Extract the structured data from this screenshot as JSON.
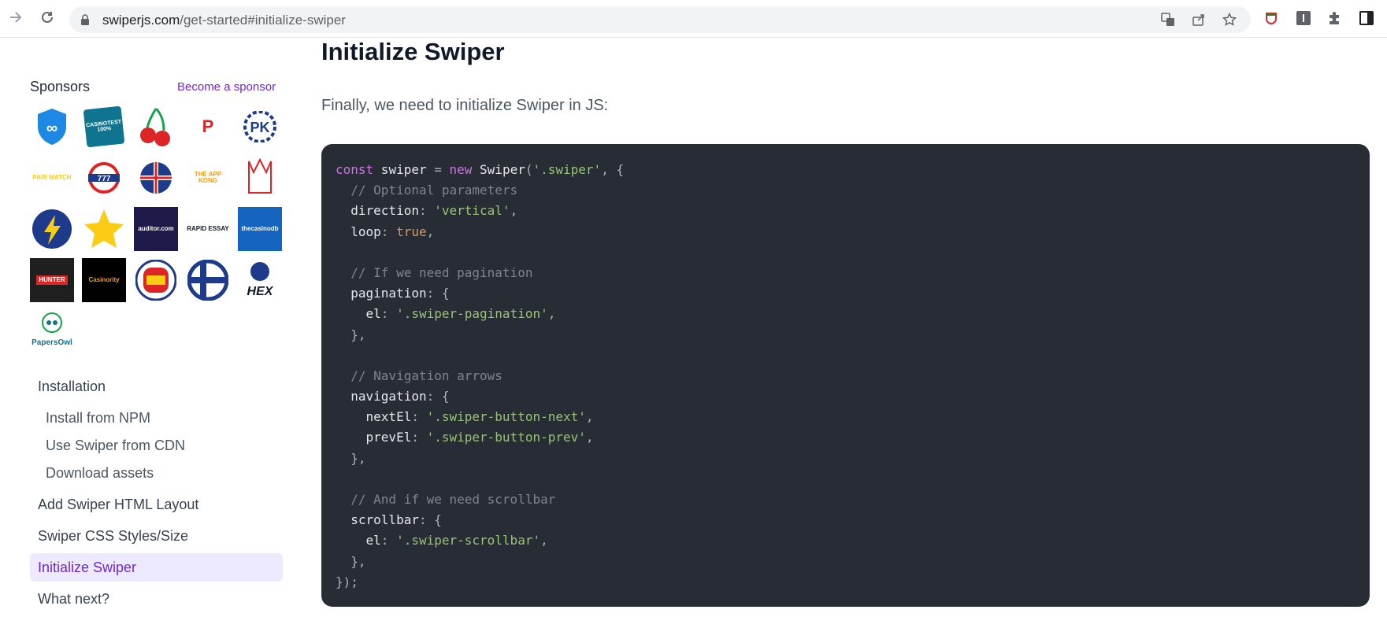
{
  "browser": {
    "url_host": "swiperjs.com",
    "url_path": "/get-started#initialize-swiper"
  },
  "sidebar": {
    "sponsors_title": "Sponsors",
    "become_sponsor": "Become a sponsor",
    "sponsors": [
      {
        "name": "shield-logo",
        "label": "",
        "color": "#1e88e5"
      },
      {
        "name": "casinotest-logo",
        "label": "CASINOTEST",
        "color": "#0e7490"
      },
      {
        "name": "cherry-logo",
        "label": "",
        "color": "#dc2626"
      },
      {
        "name": "p-logo",
        "label": "P",
        "color": "#dc2626"
      },
      {
        "name": "pk-logo",
        "label": "PK",
        "color": "#1e3a8a"
      },
      {
        "name": "parimatch-logo",
        "label": "PARI MATCH",
        "color": "#facc15"
      },
      {
        "name": "777-logo",
        "label": "777",
        "color": "#dc2626"
      },
      {
        "name": "uk-logo",
        "label": "",
        "color": "#1e3a8a"
      },
      {
        "name": "theappkong-logo",
        "label": "THE APP KONG",
        "color": "#f59e0b"
      },
      {
        "name": "crown-logo",
        "label": "",
        "color": "#dc2626"
      },
      {
        "name": "lightning-logo",
        "label": "",
        "color": "#1e3a8a"
      },
      {
        "name": "star-logo",
        "label": "",
        "color": "#facc15"
      },
      {
        "name": "auditor-logo",
        "label": "auditor.com",
        "color": "#1e1b4b"
      },
      {
        "name": "rapidessay-logo",
        "label": "RAPID ESSAY",
        "color": "#111827"
      },
      {
        "name": "thecasinodb-logo",
        "label": "thecasinodb",
        "color": "#1565c0"
      },
      {
        "name": "casinohunter-logo",
        "label": "HUNTER",
        "color": "#dc2626"
      },
      {
        "name": "casinority-logo",
        "label": "Casinority",
        "color": "#f59e0b"
      },
      {
        "name": "dutch-logo",
        "label": "",
        "color": "#dc2626"
      },
      {
        "name": "finland-logo",
        "label": "",
        "color": "#1e3a8a"
      },
      {
        "name": "hex-logo",
        "label": "HEX",
        "color": "#111827"
      },
      {
        "name": "papersowl-logo",
        "label": "PapersOwl",
        "color": "#0e7490"
      }
    ],
    "nav": {
      "installation": "Installation",
      "install_npm": "Install from NPM",
      "use_cdn": "Use Swiper from CDN",
      "download_assets": "Download assets",
      "add_layout": "Add Swiper HTML Layout",
      "css_styles": "Swiper CSS Styles/Size",
      "initialize": "Initialize Swiper",
      "what_next": "What next?"
    }
  },
  "main": {
    "title": "Initialize Swiper",
    "intro": "Finally, we need to initialize Swiper in JS:",
    "code_lines": [
      [
        {
          "t": "kw",
          "v": "const"
        },
        {
          "t": "prop",
          "v": " swiper "
        },
        {
          "t": "punc",
          "v": "= "
        },
        {
          "t": "kw",
          "v": "new"
        },
        {
          "t": "fn",
          "v": " Swiper"
        },
        {
          "t": "punc",
          "v": "("
        },
        {
          "t": "str",
          "v": "'.swiper'"
        },
        {
          "t": "punc",
          "v": ", {"
        }
      ],
      [
        {
          "t": "cmt",
          "v": "  // Optional parameters"
        }
      ],
      [
        {
          "t": "prop",
          "v": "  direction"
        },
        {
          "t": "punc",
          "v": ": "
        },
        {
          "t": "str",
          "v": "'vertical'"
        },
        {
          "t": "punc",
          "v": ","
        }
      ],
      [
        {
          "t": "prop",
          "v": "  loop"
        },
        {
          "t": "punc",
          "v": ": "
        },
        {
          "t": "bool",
          "v": "true"
        },
        {
          "t": "punc",
          "v": ","
        }
      ],
      [],
      [
        {
          "t": "cmt",
          "v": "  // If we need pagination"
        }
      ],
      [
        {
          "t": "prop",
          "v": "  pagination"
        },
        {
          "t": "punc",
          "v": ": {"
        }
      ],
      [
        {
          "t": "prop",
          "v": "    el"
        },
        {
          "t": "punc",
          "v": ": "
        },
        {
          "t": "str",
          "v": "'.swiper-pagination'"
        },
        {
          "t": "punc",
          "v": ","
        }
      ],
      [
        {
          "t": "punc",
          "v": "  },"
        }
      ],
      [],
      [
        {
          "t": "cmt",
          "v": "  // Navigation arrows"
        }
      ],
      [
        {
          "t": "prop",
          "v": "  navigation"
        },
        {
          "t": "punc",
          "v": ": {"
        }
      ],
      [
        {
          "t": "prop",
          "v": "    nextEl"
        },
        {
          "t": "punc",
          "v": ": "
        },
        {
          "t": "str",
          "v": "'.swiper-button-next'"
        },
        {
          "t": "punc",
          "v": ","
        }
      ],
      [
        {
          "t": "prop",
          "v": "    prevEl"
        },
        {
          "t": "punc",
          "v": ": "
        },
        {
          "t": "str",
          "v": "'.swiper-button-prev'"
        },
        {
          "t": "punc",
          "v": ","
        }
      ],
      [
        {
          "t": "punc",
          "v": "  },"
        }
      ],
      [],
      [
        {
          "t": "cmt",
          "v": "  // And if we need scrollbar"
        }
      ],
      [
        {
          "t": "prop",
          "v": "  scrollbar"
        },
        {
          "t": "punc",
          "v": ": {"
        }
      ],
      [
        {
          "t": "prop",
          "v": "    el"
        },
        {
          "t": "punc",
          "v": ": "
        },
        {
          "t": "str",
          "v": "'.swiper-scrollbar'"
        },
        {
          "t": "punc",
          "v": ","
        }
      ],
      [
        {
          "t": "punc",
          "v": "  },"
        }
      ],
      [
        {
          "t": "punc",
          "v": "});"
        }
      ]
    ]
  }
}
